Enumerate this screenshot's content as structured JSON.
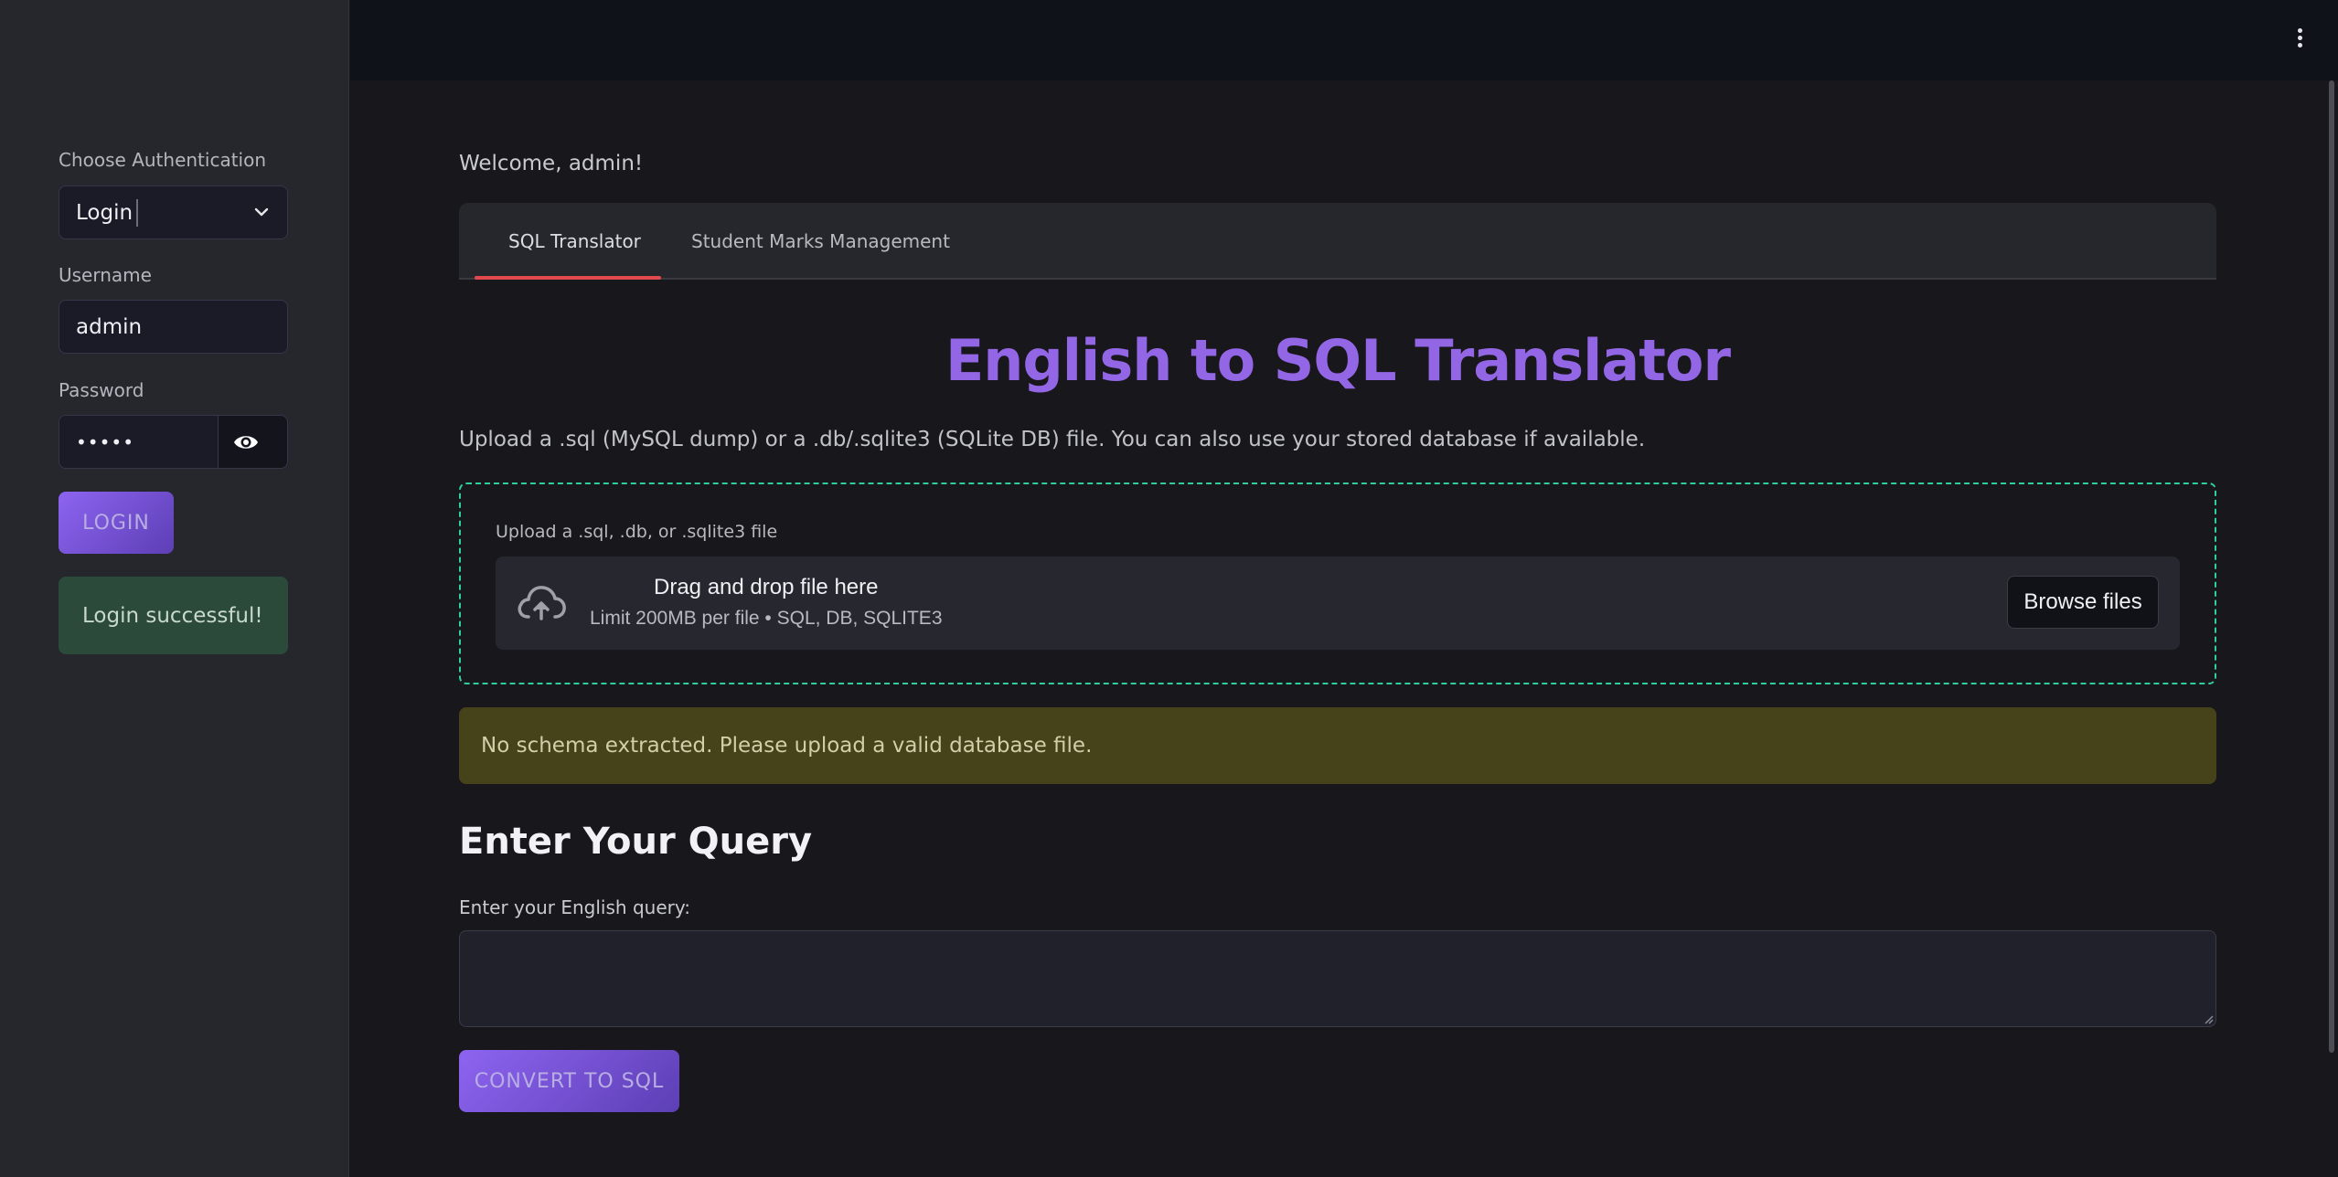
{
  "sidebar": {
    "auth_label": "Choose Authentication",
    "auth_value": "Login",
    "username_label": "Username",
    "username_value": "admin",
    "password_label": "Password",
    "password_value": "•••••",
    "login_button": "LOGIN",
    "success_message": "Login successful!"
  },
  "main": {
    "welcome": "Welcome, admin!",
    "tabs": [
      {
        "label": "SQL Translator",
        "active": true
      },
      {
        "label": "Student Marks Management",
        "active": false
      }
    ],
    "title": "English to SQL Translator",
    "description": "Upload a .sql (MySQL dump) or a .db/.sqlite3 (SQLite DB) file. You can also use your stored database if available.",
    "upload": {
      "label": "Upload a .sql, .db, or .sqlite3 file",
      "drop_title": "Drag and drop file here",
      "drop_limit": "Limit 200MB per file • SQL, DB, SQLITE3",
      "browse_button": "Browse files"
    },
    "warning": "No schema extracted. Please upload a valid database file.",
    "query_heading": "Enter Your Query",
    "query_label": "Enter your English query:",
    "query_value": "",
    "convert_button": "CONVERT TO SQL"
  },
  "colors": {
    "accent": "#9366e6",
    "tab_underline": "#e1494f",
    "dropzone_border": "#2fcf9b",
    "success_bg": "#2b4a3a",
    "warning_bg": "#464219"
  },
  "icons": [
    "chevron-down-icon",
    "eye-icon",
    "cloud-upload-icon",
    "kebab-menu-icon"
  ]
}
